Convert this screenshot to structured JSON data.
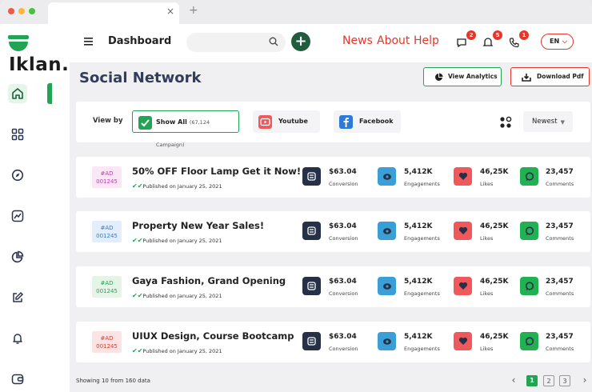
{
  "browser": {
    "new_tab": "+",
    "close_tab": "×"
  },
  "brand": {
    "name": "Iklan."
  },
  "header": {
    "title": "Dashboard",
    "search_placeholder": "",
    "nav": [
      "News",
      "About",
      "Help"
    ],
    "badges": [
      "2",
      "5",
      "1"
    ],
    "lang": "EN"
  },
  "main": {
    "title": "Social Network",
    "view_analytics": "View Analytics",
    "download_pdf": "Download Pdf"
  },
  "filters": {
    "view_by": "View by",
    "show_all": "Show All",
    "show_all_sub": "(67,124 Campaign)",
    "youtube": "Youtube",
    "facebook": "Facebook",
    "sort": "Newest"
  },
  "rows": [
    {
      "tag": "#AD\n001245",
      "tag_bg": "#fbe6f6",
      "tag_color": "#c239b3",
      "title": "50% OFF Floor Lamp Get it Now!",
      "published": "Published on January 25, 2021",
      "conversion": "$63.04",
      "engagements": "5,412K",
      "likes": "46,25K",
      "comments": "23,457"
    },
    {
      "tag": "#AD\n001245",
      "tag_bg": "#e2eefb",
      "tag_color": "#3a79c8",
      "title": "Property New Year Sales!",
      "published": "Published on January 25, 2021",
      "conversion": "$63.04",
      "engagements": "5,412K",
      "likes": "46,25K",
      "comments": "23,457"
    },
    {
      "tag": "#AD\n001245",
      "tag_bg": "#e4f5e8",
      "tag_color": "#21a453",
      "title": "Gaya Fashion, Grand Opening",
      "published": "Published on January 25, 2021",
      "conversion": "$63.04",
      "engagements": "5,412K",
      "likes": "46,25K",
      "comments": "23,457"
    },
    {
      "tag": "#AD\n001245",
      "tag_bg": "#fde4e4",
      "tag_color": "#e4362a",
      "title": "UIUX Design, Course Bootcamp",
      "published": "Published on January 25, 2021",
      "conversion": "$63.04",
      "engagements": "5,412K",
      "likes": "46,25K",
      "comments": "23,457"
    }
  ],
  "labels": {
    "conversion": "Conversion",
    "engagements": "Engagements",
    "likes": "Likes",
    "comments": "Comments"
  },
  "footer": {
    "showing": "Showing 10 from 160 data",
    "pages": [
      "1",
      "2",
      "3"
    ],
    "prev": "‹",
    "next": "›"
  },
  "colors": {
    "accent": "#21a453",
    "danger": "#e4362a",
    "dark": "#263047",
    "blue": "#3a9fd6",
    "red": "#f0585c"
  }
}
